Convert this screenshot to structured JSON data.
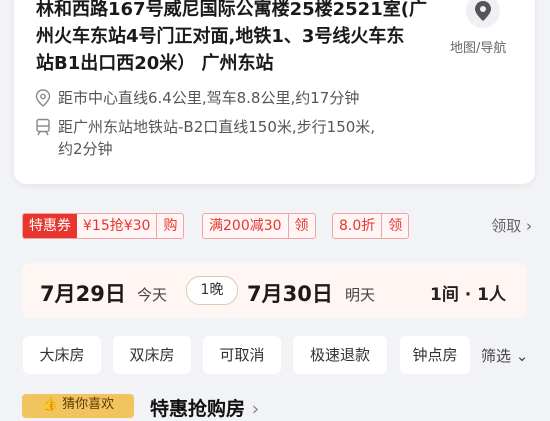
{
  "hotel": {
    "address_lines": [
      "林和西路167号威尼国际公寓楼25楼2521室(广",
      "州火车东站4号门正对面,地铁1、3号线火车东",
      "站B1出口西20米）  广州东站"
    ],
    "map_nav_label": "地图/导航",
    "distance_center": "距市中心直线6.4公里,驾车8.8公里,约17分钟",
    "distance_metro_line1": "距广州东站地铁站-B2口直线150米,步行150米,",
    "distance_metro_line2": "约2分钟"
  },
  "coupons": {
    "special_label": "特惠券",
    "grab_text": "¥15抢¥30",
    "grab_action": "购",
    "discount_text": "满200减30",
    "discount_action": "领",
    "rate_text": "8.0折",
    "rate_action": "领",
    "claim_label": "领取"
  },
  "booking": {
    "checkin_date": "7月29日",
    "checkin_day": "今天",
    "nights": "1晚",
    "checkout_date": "7月30日",
    "checkout_day": "明天",
    "rooms_guests": "1间 · 1人"
  },
  "filters": {
    "chips": [
      "大床房",
      "双床房",
      "可取消",
      "极速退款",
      "钟点房"
    ],
    "more_label": "筛选"
  },
  "section": {
    "badge": "猜你喜欢",
    "title": "特惠抢购房"
  },
  "colors": {
    "accent_red": "#e6362e",
    "date_bg": "#fff5f3",
    "badge_gold": "#f2c460"
  }
}
